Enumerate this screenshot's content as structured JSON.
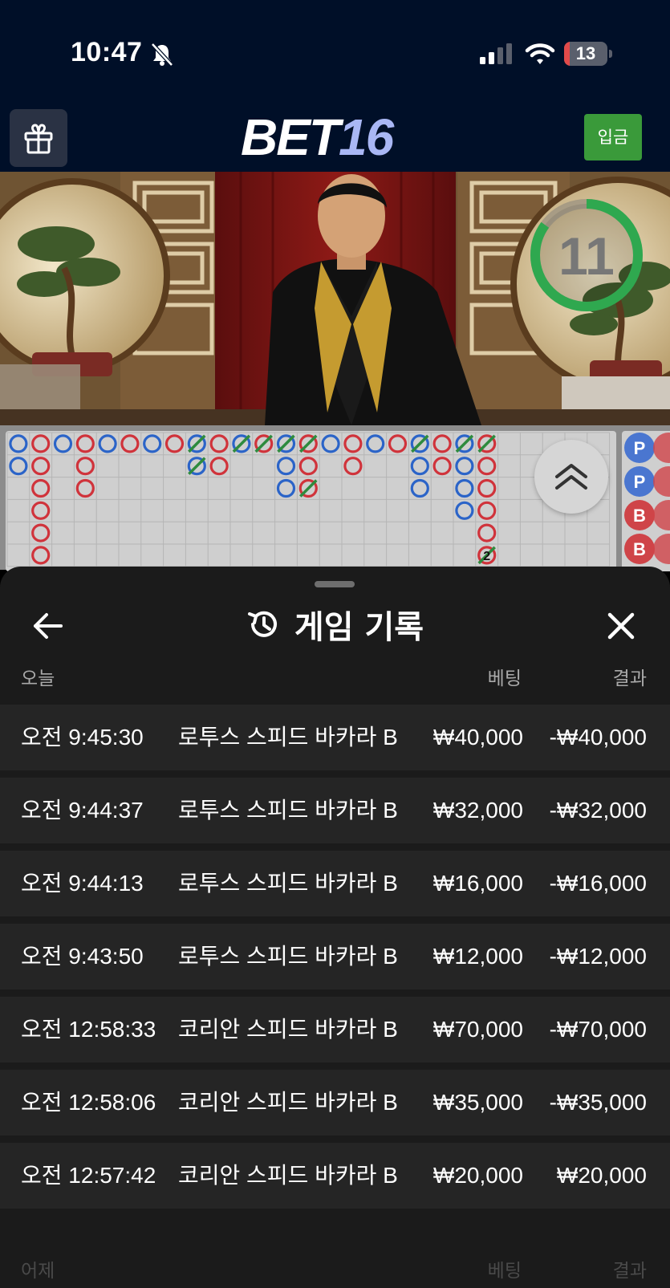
{
  "status_bar": {
    "time": "10:47",
    "battery": "13",
    "battery_level": 0.13,
    "icons": [
      "bell-slash-icon",
      "cellular-signal-icon",
      "wifi-icon",
      "battery-icon"
    ]
  },
  "header": {
    "logo_part1": "BET",
    "logo_part2": "16",
    "deposit_label": "입금",
    "gift_icon": "gift-icon"
  },
  "video": {
    "countdown": "11",
    "countdown_fraction": 0.85,
    "ring_color": "#2fa84f"
  },
  "roadmap": {
    "side_labels": [
      "P",
      "P",
      "B",
      "B"
    ],
    "tie_count_label": "2",
    "colors": {
      "player": "#2b64c8",
      "banker": "#d0333b",
      "tie": "#2e8b3e"
    }
  },
  "history": {
    "title": "게임 기록",
    "today_label": "오늘",
    "bet_label": "베팅",
    "result_label": "결과",
    "rows": [
      {
        "time": "오전 9:45:30",
        "game": "로투스 스피드 바카라 B",
        "bet": "₩40,000",
        "result": "-₩40,000"
      },
      {
        "time": "오전 9:44:37",
        "game": "로투스 스피드 바카라 B",
        "bet": "₩32,000",
        "result": "-₩32,000"
      },
      {
        "time": "오전 9:44:13",
        "game": "로투스 스피드 바카라 B",
        "bet": "₩16,000",
        "result": "-₩16,000"
      },
      {
        "time": "오전 9:43:50",
        "game": "로투스 스피드 바카라 B",
        "bet": "₩12,000",
        "result": "-₩12,000"
      },
      {
        "time": "오전 12:58:33",
        "game": "코리안 스피드 바카라 B",
        "bet": "₩70,000",
        "result": "-₩70,000"
      },
      {
        "time": "오전 12:58:06",
        "game": "코리안 스피드 바카라 B",
        "bet": "₩35,000",
        "result": "-₩35,000"
      },
      {
        "time": "오전 12:57:42",
        "game": "코리안 스피드 바카라 B",
        "bet": "₩20,000",
        "result": "₩20,000"
      }
    ],
    "yesterday_label": "어제",
    "yesterday_bet_label": "베팅",
    "yesterday_result_label": "결과"
  }
}
